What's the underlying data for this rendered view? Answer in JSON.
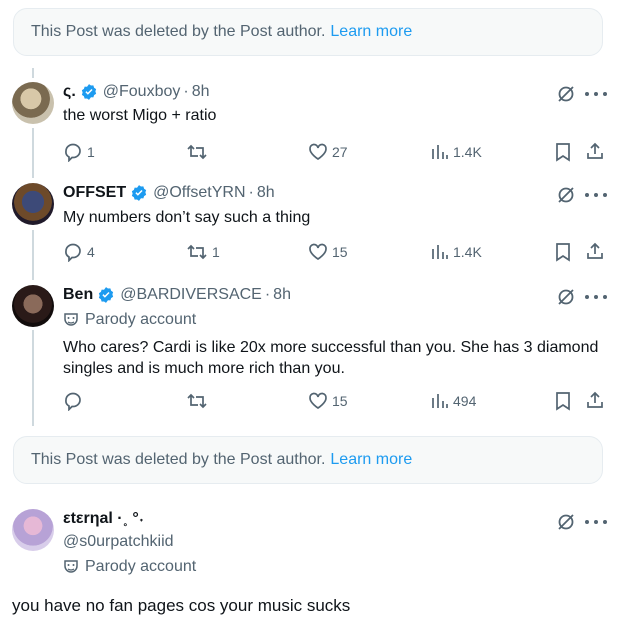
{
  "deleted_notice": {
    "text": "This Post was deleted by the Post author.",
    "link": "Learn more"
  },
  "replies": [
    {
      "name": "ς.",
      "handle": "@Fouxboy",
      "separator": "·",
      "time": "8h",
      "verified": true,
      "text": "the worst Migo + ratio",
      "stats": {
        "replies": "1",
        "reposts": "",
        "likes": "27",
        "views": "1.4K"
      }
    },
    {
      "name": "OFFSET",
      "handle": "@OffsetYRN",
      "separator": "·",
      "time": "8h",
      "verified": true,
      "text": "My numbers don’t say such a thing",
      "stats": {
        "replies": "4",
        "reposts": "1",
        "likes": "15",
        "views": "1.4K"
      }
    },
    {
      "name": "Ben",
      "handle": "@BARDIVERSACE",
      "separator": "·",
      "time": "8h",
      "verified": true,
      "parody_label": "Parody account",
      "text_line1": "Who cares? Cardi is like 20x more successful than you. She has 3 diamond",
      "text_line2": "singles and is much more rich than you.",
      "stats": {
        "replies": "",
        "reposts": "",
        "likes": "15",
        "views": "494"
      }
    },
    {
      "name": "εtεrηal ·˳ °˖",
      "handle": "@s0urpatchkiid",
      "parody_label": "Parody account",
      "text": "you have no fan pages cos your music sucks"
    }
  ],
  "colors": {
    "accent": "#1d9bf0",
    "secondary_text": "#536471",
    "primary_text": "#0f1419",
    "notice_bg": "#f7f9f9",
    "thread_line": "#cfd9de"
  }
}
